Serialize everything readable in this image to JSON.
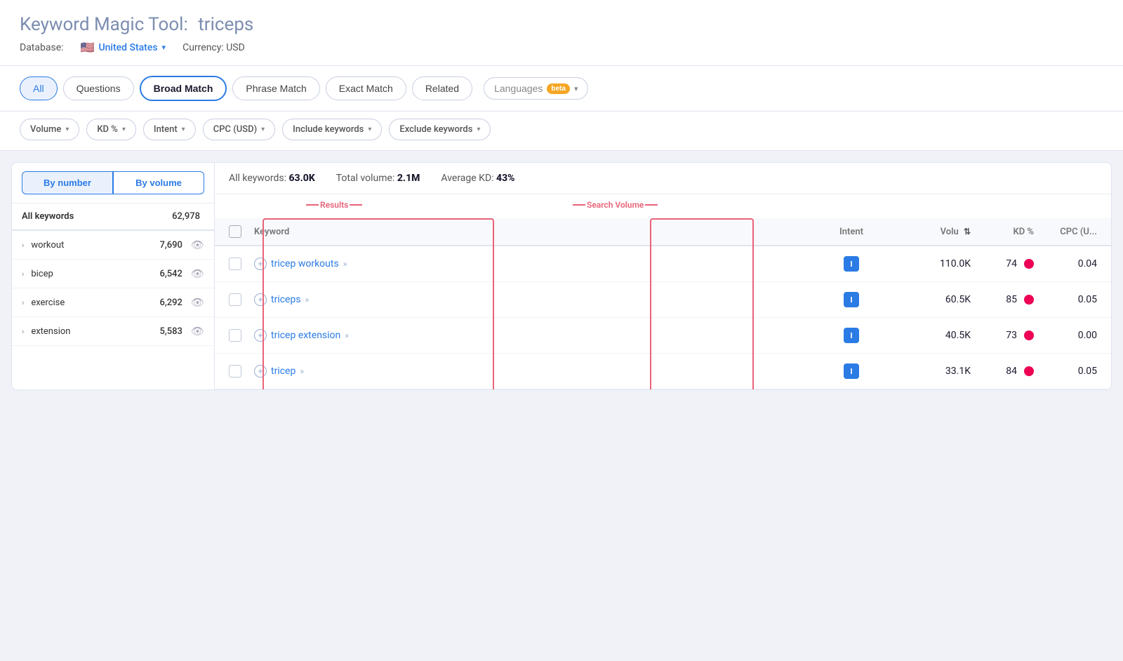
{
  "header": {
    "title_prefix": "Keyword Magic Tool:",
    "title_query": "triceps",
    "database_label": "Database:",
    "database_flag": "🇺🇸",
    "database_name": "United States",
    "currency_label": "Currency: USD"
  },
  "tabs": [
    {
      "id": "all",
      "label": "All",
      "active": true
    },
    {
      "id": "questions",
      "label": "Questions",
      "active": false
    },
    {
      "id": "broad-match",
      "label": "Broad Match",
      "active": false,
      "selected": true
    },
    {
      "id": "phrase-match",
      "label": "Phrase Match",
      "active": false
    },
    {
      "id": "exact-match",
      "label": "Exact Match",
      "active": false
    },
    {
      "id": "related",
      "label": "Related",
      "active": false
    }
  ],
  "languages_btn": "Languages",
  "beta_label": "beta",
  "filters": [
    {
      "id": "volume",
      "label": "Volume"
    },
    {
      "id": "kd",
      "label": "KD %"
    },
    {
      "id": "intent",
      "label": "Intent"
    },
    {
      "id": "cpc",
      "label": "CPC (USD)"
    },
    {
      "id": "include",
      "label": "Include keywords"
    },
    {
      "id": "exclude",
      "label": "Exclude keywords"
    }
  ],
  "sidebar": {
    "toggle_by_number": "By number",
    "toggle_by_volume": "By volume",
    "header_label": "All keywords",
    "header_count": "62,978",
    "rows": [
      {
        "label": "workout",
        "count": "7,690",
        "has_chevron": true
      },
      {
        "label": "bicep",
        "count": "6,542",
        "has_chevron": true
      },
      {
        "label": "exercise",
        "count": "6,292",
        "has_chevron": true
      },
      {
        "label": "extension",
        "count": "5,583",
        "has_chevron": true
      }
    ]
  },
  "stats": {
    "all_keywords_label": "All keywords:",
    "all_keywords_value": "63.0K",
    "total_volume_label": "Total volume:",
    "total_volume_value": "2.1M",
    "avg_kd_label": "Average KD:",
    "avg_kd_value": "43%"
  },
  "annotations": {
    "results_label": "Results",
    "search_volume_label": "Search Volume"
  },
  "table": {
    "columns": [
      {
        "id": "keyword",
        "label": "Keyword"
      },
      {
        "id": "intent",
        "label": "Intent"
      },
      {
        "id": "volume",
        "label": "Volu",
        "sortable": true
      },
      {
        "id": "kd",
        "label": "KD %"
      },
      {
        "id": "cpc",
        "label": "CPC (U..."
      }
    ],
    "rows": [
      {
        "keyword": "tricep workouts",
        "intent": "I",
        "volume": "110.0K",
        "kd": "74",
        "cpc": "0.04",
        "kd_color": "#dd0033"
      },
      {
        "keyword": "triceps",
        "intent": "I",
        "volume": "60.5K",
        "kd": "85",
        "cpc": "0.05",
        "kd_color": "#dd0033"
      },
      {
        "keyword": "tricep extension",
        "intent": "I",
        "volume": "40.5K",
        "kd": "73",
        "cpc": "0.00",
        "kd_color": "#dd0033"
      },
      {
        "keyword": "tricep",
        "intent": "I",
        "volume": "33.1K",
        "kd": "84",
        "cpc": "0.05",
        "kd_color": "#dd0033"
      }
    ]
  }
}
